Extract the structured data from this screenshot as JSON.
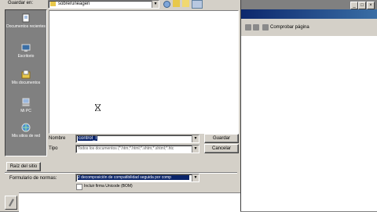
{
  "dialog": {
    "save_in_label": "Guardar en:",
    "save_in_value": "sobreruneagen",
    "places": [
      {
        "label": "Documentos recientes"
      },
      {
        "label": "Escritorio"
      },
      {
        "label": "Mis documentos"
      },
      {
        "label": "Mi PC"
      },
      {
        "label": "Mis sitios de red"
      }
    ],
    "name_label": "Nombre",
    "name_value": "control_I",
    "type_label": "Tipo",
    "type_value": "Todos los documentos (*.htm;*.html;*.shtm;*.shtml;*.htc",
    "save_button": "Guardar",
    "cancel_button": "Cancelar",
    "root_button": "Raíz del sitio",
    "standards_label": "Formulario de normas:",
    "standards_value": "2 decomposición de compatibilidad seguida por comp",
    "bom_label": "Incluir firma Unicode (BOM)"
  },
  "editor": {
    "check_page_label": "Comprobar página"
  }
}
